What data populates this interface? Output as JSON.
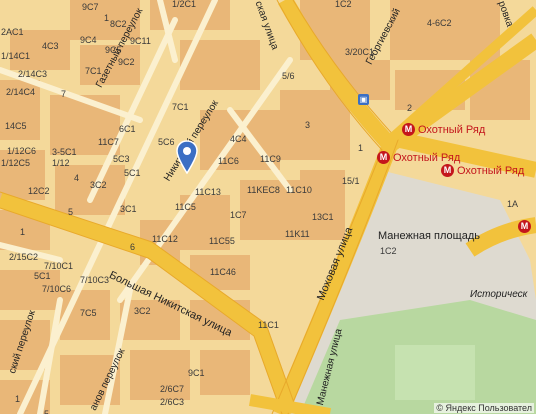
{
  "colors": {
    "land": "#f4d99a",
    "building": "#e9b778",
    "major_road": "#f2c23c",
    "minor_road": "#fbf0cf",
    "square": "#dedad0",
    "park": "#b8d8a0",
    "metro": "#c4161c",
    "pin": "#3b6fc4"
  },
  "streets": [
    {
      "name": "Газетный переулок"
    },
    {
      "name": "Никитский переулок"
    },
    {
      "name": "Большая Никитская улица"
    },
    {
      "name": "Моховая улица"
    },
    {
      "name": "Манежная улица"
    },
    {
      "name": "Георгиевский"
    },
    {
      "name": "ская улица"
    },
    {
      "name": "ский переулок"
    },
    {
      "name": "анов переулок"
    },
    {
      "name": "ровка"
    }
  ],
  "places": [
    {
      "name": "Манежная площадь"
    },
    {
      "name": "Историческ"
    }
  ],
  "metro": [
    {
      "name": "Охотный Ряд",
      "icon": "M"
    },
    {
      "name": "Охотный Ряд",
      "icon": "M"
    },
    {
      "name": "Охотный Ряд",
      "icon": "M"
    },
    {
      "name": "",
      "icon": "M"
    }
  ],
  "house_numbers": [
    "9C7",
    "1/2C1",
    "1C2",
    "8C2",
    "2AC1",
    "9C4",
    "4C3",
    "9C5",
    "9C11",
    "1/14C1",
    "2/14C3",
    "7C1",
    "9C2",
    "2/14C4",
    "5/6",
    "4-6C2",
    "3/20C1",
    "7C1",
    "2",
    "14C5",
    "5C6",
    "6C1",
    "4C4",
    "3",
    "5C3",
    "1/12C6",
    "3-5C1",
    "1/12",
    "11C6",
    "11C9",
    "1",
    "11C7",
    "5C1",
    "1/12C5",
    "3C2",
    "11C13",
    "11KEC8",
    "11C10",
    "15/1",
    "12C2",
    "3C1",
    "11C5",
    "13C1",
    "1A",
    "1C7",
    "11C12",
    "11C55",
    "11K11",
    "1C2",
    "2/15C2",
    "6",
    "7/10C1",
    "11C46",
    "7/10C3",
    "5C1",
    "7/10C6",
    "3C2",
    "11C1",
    "7C5",
    "2/6C7",
    "9C1",
    "2/6C3",
    "1",
    "4",
    "7",
    "5",
    "1",
    "1",
    "5"
  ],
  "copyright": "© Яндекс Пользовател"
}
